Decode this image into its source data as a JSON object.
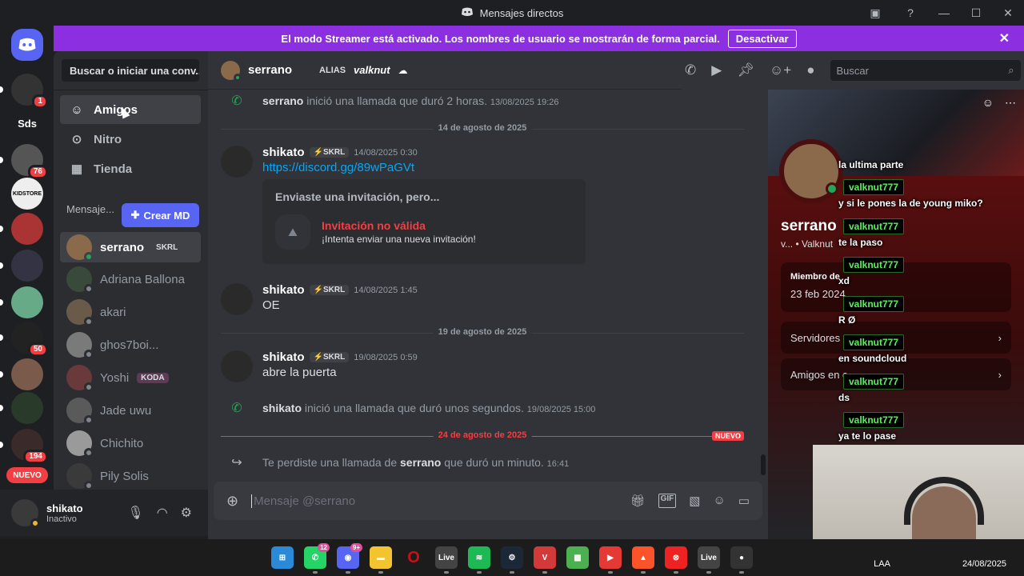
{
  "window": {
    "title": "Mensajes directos",
    "controls": [
      "inbox-icon",
      "help-icon",
      "minimize",
      "maximize",
      "close"
    ]
  },
  "banner": {
    "text": "El modo Streamer está activado. Los nombres de usuario se mostrarán de forma parcial.",
    "button": "Desactivar",
    "color": "#8b2fe0"
  },
  "servers": [
    {
      "label": "",
      "icon": "discord-logo-icon",
      "color": "#5865f2"
    },
    {
      "label": "",
      "badge": "1",
      "color": "#333"
    },
    {
      "label": "Sds",
      "color": "#1e1f22"
    },
    {
      "label": "",
      "badge": "76",
      "color": "#555"
    },
    {
      "label": "KIDSTORE",
      "color": "#eee"
    },
    {
      "label": "",
      "color": "#a33"
    },
    {
      "label": "",
      "color": "#334"
    },
    {
      "label": "",
      "color": "#6a8"
    },
    {
      "label": "",
      "badge": "50",
      "color": "#222"
    },
    {
      "label": "",
      "color": "#7a5a4a"
    },
    {
      "label": "",
      "color": "#2a3a2a"
    },
    {
      "label": "",
      "badge": "194",
      "color": "#3a2a2a"
    }
  ],
  "servers_nuevo": "NUEVO",
  "dm_panel": {
    "search_label": "Buscar o iniciar una conv...",
    "nav": [
      {
        "label": "Amigos",
        "icon": "friends-icon"
      },
      {
        "label": "Nitro",
        "icon": "nitro-icon"
      },
      {
        "label": "Tienda",
        "icon": "shop-icon"
      }
    ],
    "header": "Mensaje...",
    "create_button": "Crear MD",
    "dms": [
      {
        "name": "serrano",
        "tag": "SKRL",
        "status": "online"
      },
      {
        "name": "Adriana Ballona",
        "status": "offline"
      },
      {
        "name": "akari",
        "status": "offline"
      },
      {
        "name": "ghos7boi...",
        "status": "offline"
      },
      {
        "name": "Yoshi",
        "tag": "KODA",
        "status": "offline"
      },
      {
        "name": "Jade uwu",
        "status": "offline"
      },
      {
        "name": "Chichito",
        "status": "offline"
      },
      {
        "name": "Pily Solis",
        "status": "offline"
      }
    ]
  },
  "user_panel": {
    "name": "shikato",
    "status": "Inactivo"
  },
  "chat": {
    "recipient": "serrano",
    "alias_label": "ALIAS",
    "alias_value": "valknut",
    "search_placeholder": "Buscar",
    "events": {
      "call1": {
        "user": "serrano",
        "text": "inició una llamada que duró 2 horas.",
        "time": "13/08/2025 19:26"
      },
      "date1": "14 de agosto de 2025",
      "msg1": {
        "author": "shikato",
        "tag": "SKRL",
        "time": "14/08/2025 0:30",
        "link": "https://discord.gg/89wPaGVt"
      },
      "invite": {
        "title": "Enviaste una invitación, pero...",
        "invalid": "Invitación no válida",
        "sub": "¡Intenta enviar una nueva invitación!"
      },
      "msg2": {
        "author": "shikato",
        "tag": "SKRL",
        "time": "14/08/2025 1:45",
        "text": "OE"
      },
      "date2": "19 de agosto de 2025",
      "msg3": {
        "author": "shikato",
        "tag": "SKRL",
        "time": "19/08/2025 0:59",
        "text": "abre la puerta"
      },
      "call2": {
        "user": "shikato",
        "text": "inició una llamada que duró unos segundos.",
        "time": "19/08/2025 15:00"
      },
      "date3": "24 de agosto de 2025",
      "new_badge": "NUEVO",
      "missed": {
        "pre": "Te perdiste una llamada de",
        "user": "serrano",
        "post": "que duró un minuto.",
        "time": "16:41"
      }
    },
    "composer_placeholder": "Mensaje @serrano"
  },
  "profile": {
    "name": "serrano",
    "sub": "v... •  Valknut",
    "member_since_label": "Miembro de",
    "member_since": "23 feb 2024",
    "servers_label": "Servidores e",
    "friends_label": "Amigos en c"
  },
  "stream_chat": [
    {
      "user": "",
      "text": "la ultima parte"
    },
    {
      "user": "valknut777",
      "text": "y si le pones la de young miko?"
    },
    {
      "user": "valknut777",
      "text": "te la paso"
    },
    {
      "user": "valknut777",
      "text": "xd"
    },
    {
      "user": "valknut777",
      "text": "R Ø"
    },
    {
      "user": "valknut777",
      "text": "en soundcloud"
    },
    {
      "user": "valknut777",
      "text": "ds"
    },
    {
      "user": "valknut777",
      "text": "ya te lo pase"
    }
  ],
  "taskbar": {
    "apps": [
      "windows-start-icon",
      "whatsapp-icon",
      "discord-icon",
      "file-explorer-icon",
      "opera-icon",
      "live-icon",
      "spotify-icon",
      "steam-icon",
      "valorant-icon",
      "minecraft-icon",
      "app-red-icon",
      "brave-icon",
      "app-icon",
      "live-icon-2",
      "obs-icon"
    ],
    "whatsapp_badge": "12",
    "discord_badge": "9+",
    "tray_lang": "LAA",
    "tray_date": "24/08/2025"
  }
}
